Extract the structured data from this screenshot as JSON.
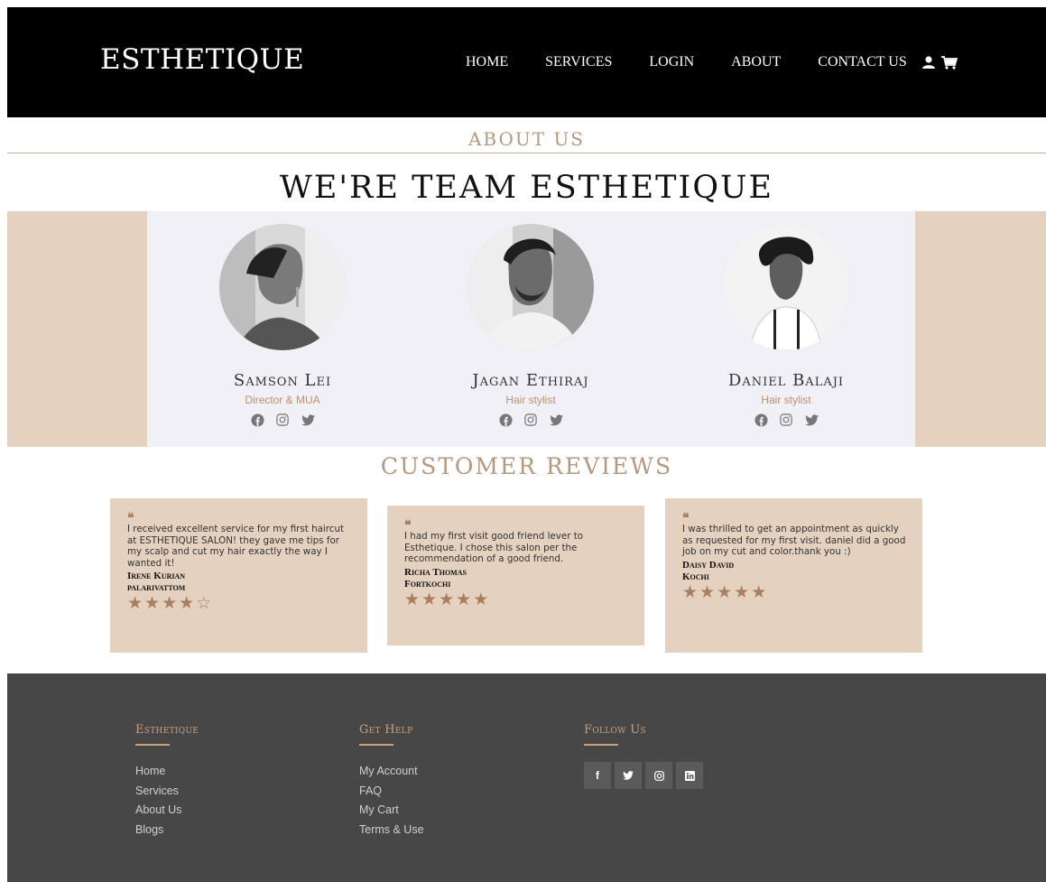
{
  "header": {
    "logo": "ESTHETIQUE",
    "nav": [
      "HOME",
      "SERVICES",
      "LOGIN",
      "ABOUT",
      "CONTACT US"
    ],
    "icons": [
      "user-icon",
      "cart-icon"
    ]
  },
  "about": {
    "section_label": "ABOUT US",
    "heading": "WE'RE TEAM ESTHETIQUE"
  },
  "team": [
    {
      "name": "Samson Lei",
      "role": "Director & MUA"
    },
    {
      "name": "Jagan Ethiraj",
      "role": "Hair stylist"
    },
    {
      "name": "Daniel Balaji",
      "role": "Hair stylist"
    }
  ],
  "reviews": {
    "heading": "CUSTOMER REVIEWS",
    "items": [
      {
        "quote": "❝",
        "text": "I received excellent service for my first haircut at ESTHETIQUE SALON! they gave me tips for my scalp and cut my hair exactly the way I wanted it!",
        "name": "Irene Kurian",
        "place": "palarivattom",
        "rating": 4
      },
      {
        "quote": "❝",
        "text": "I had my first visit good friend lever to Esthetique. I chose this salon per the recommendation of a good friend.",
        "name": "Richa Thomas",
        "place": "Fortkochi",
        "rating": 5
      },
      {
        "quote": "❝",
        "text": "I was thrilled to get an appointment as quickly as requested for my first visit. daniel did a good job on my cut and color.thank you :)",
        "name": "Daisy David",
        "place": "Kochi",
        "rating": 5
      }
    ]
  },
  "footer": {
    "col1": {
      "title": "Esthetique",
      "links": [
        "Home",
        "Services",
        "About Us",
        "Blogs"
      ]
    },
    "col2": {
      "title": "Get Help",
      "links": [
        "My Account",
        "FAQ",
        "My Cart",
        "Terms & Use"
      ]
    },
    "col3": {
      "title": "Follow Us",
      "social": [
        "facebook-icon",
        "twitter-icon",
        "instagram-icon",
        "linkedin-icon"
      ]
    }
  },
  "colors": {
    "accent": "#b5987e",
    "band": "#e5d1bf",
    "footer": "#474747"
  }
}
